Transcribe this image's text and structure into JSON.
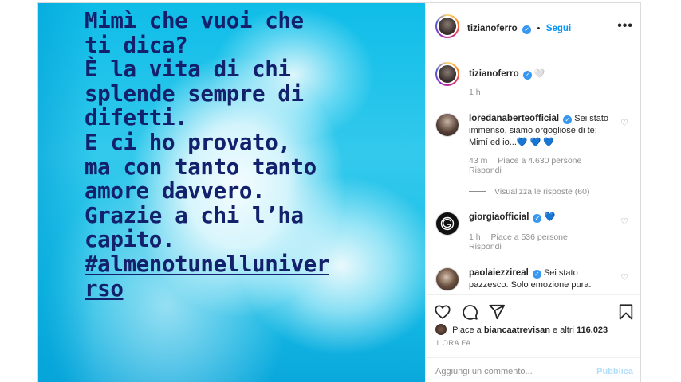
{
  "post": {
    "lines": [
      "Mimì che vuoi che",
      "ti dica?",
      "È la vita di chi",
      "splende sempre di",
      "difetti.",
      "E ci ho provato,",
      "ma con tanto tanto",
      "amore davvero.",
      "Grazie a chi l’ha",
      "capito."
    ],
    "hashtag_lines": [
      "#almenotunelluniver",
      "rso"
    ]
  },
  "header": {
    "username": "tizianoferro",
    "separator": "•",
    "follow_label": "Segui",
    "more_icon": "more-icon"
  },
  "caption": {
    "username": "tizianoferro",
    "text": "🤍",
    "time": "1 h"
  },
  "comments": [
    {
      "username": "loredanaberteofficial",
      "text": "Sei stato immenso, siamo orgogliose di te: Mimí ed io...💙 💙 💙",
      "time": "43 m",
      "likes": "Piace a 4.630 persone",
      "reply": "Rispondi",
      "view_replies": "Visualizza le risposte (60)"
    },
    {
      "username": "giorgiaofficial",
      "text": "💙",
      "time": "1 h",
      "likes": "Piace a 536 persone",
      "reply": "Rispondi"
    },
    {
      "username": "paolaiezzireal",
      "text": "Sei stato pazzesco. Solo emozione pura."
    }
  ],
  "actions": {
    "icons": [
      "heart-icon",
      "comment-icon",
      "share-icon",
      "bookmark-icon"
    ],
    "likes_prefix": "Piace a",
    "likes_user": "biancaatrevisan",
    "likes_suffix": "e altri",
    "likes_count": "116.023",
    "date": "1 ORA FA"
  },
  "add_comment": {
    "placeholder": "Aggiungi un commento...",
    "publish_label": "Pubblica"
  },
  "colors": {
    "link": "#0095f6",
    "verified": "#3897f0",
    "text_dark": "#13206b",
    "muted": "#8e8e8e"
  }
}
